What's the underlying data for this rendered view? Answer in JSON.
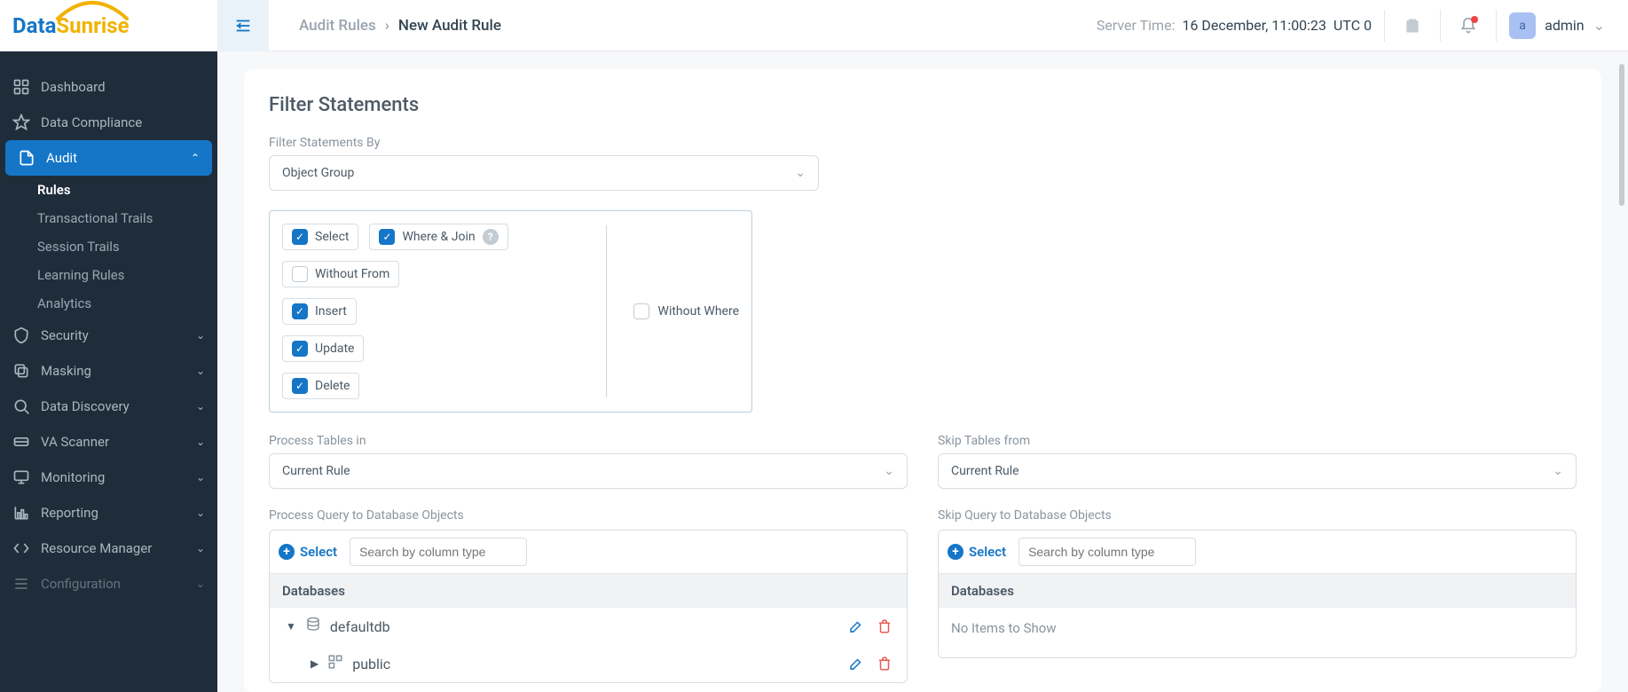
{
  "logo": {
    "part1": "Data",
    "part2": "Sunrise"
  },
  "breadcrumb": {
    "parent": "Audit Rules",
    "current": "New Audit Rule"
  },
  "server_time": {
    "label": "Server Time:",
    "value": "16 December, 11:00:23",
    "tz": "UTC 0"
  },
  "user": {
    "avatar": "a",
    "name": "admin"
  },
  "sidebar": {
    "dashboard": "Dashboard",
    "data_compliance": "Data Compliance",
    "audit": "Audit",
    "audit_sub": [
      "Rules",
      "Transactional Trails",
      "Session Trails",
      "Learning Rules",
      "Analytics"
    ],
    "security": "Security",
    "masking": "Masking",
    "data_discovery": "Data Discovery",
    "va_scanner": "VA Scanner",
    "monitoring": "Monitoring",
    "reporting": "Reporting",
    "resource_manager": "Resource Manager",
    "configuration": "Configuration"
  },
  "section": {
    "title": "Filter Statements",
    "filter_label": "Filter Statements By",
    "filter_value": "Object Group",
    "chips": {
      "select": "Select",
      "where_join": "Where & Join",
      "without_from": "Without From",
      "insert": "Insert",
      "update": "Update",
      "delete": "Delete",
      "without_where": "Without Where"
    }
  },
  "process": {
    "label": "Process Tables in",
    "value": "Current Rule",
    "query_label": "Process Query to Database Objects",
    "select_btn": "Select",
    "search_placeholder": "Search by column type",
    "databases_header": "Databases",
    "db_name": "defaultdb",
    "schema_name": "public"
  },
  "skip": {
    "label": "Skip Tables from",
    "value": "Current Rule",
    "query_label": "Skip Query to Database Objects",
    "select_btn": "Select",
    "search_placeholder": "Search by column type",
    "databases_header": "Databases",
    "empty": "No Items to Show"
  }
}
